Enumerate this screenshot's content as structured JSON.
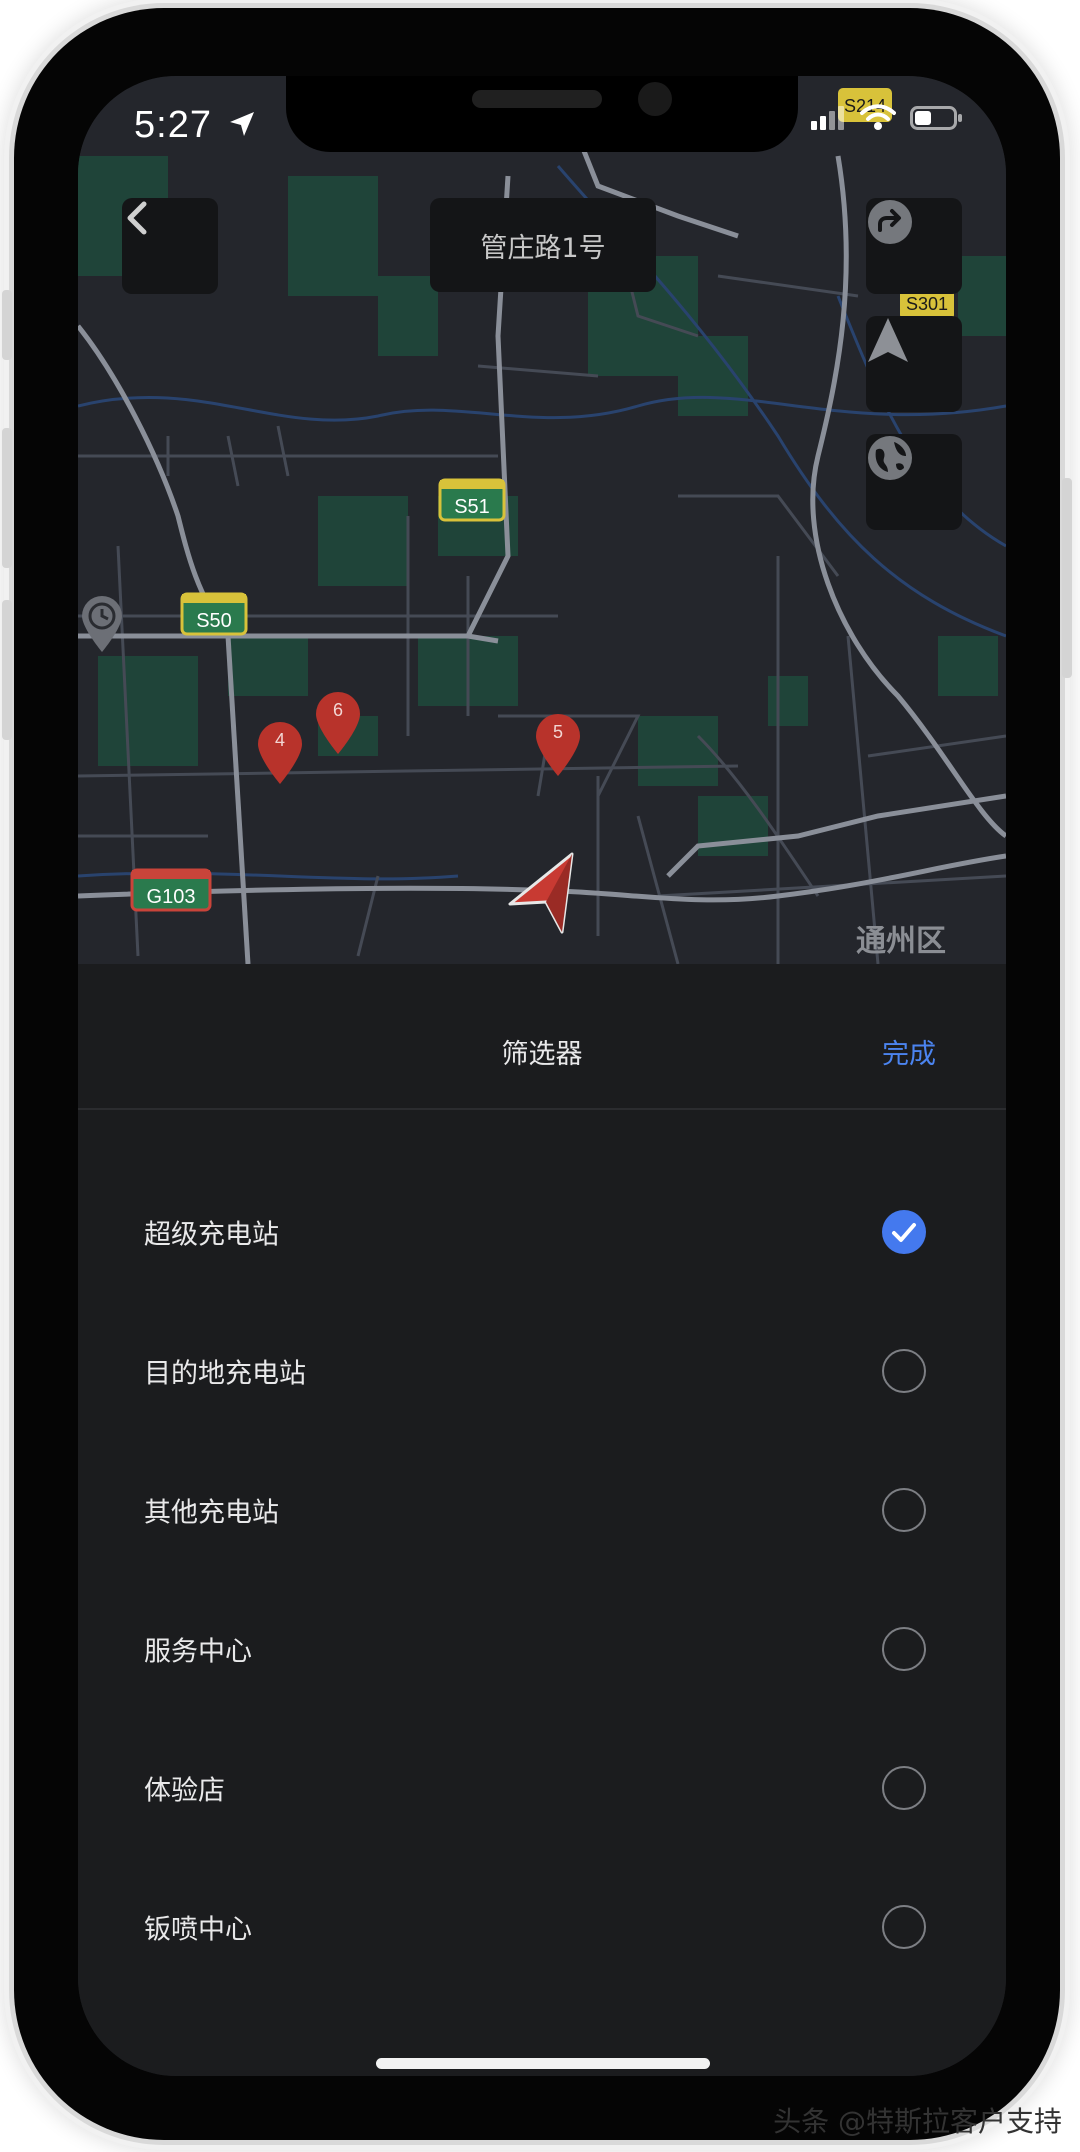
{
  "status_bar": {
    "time": "5:27"
  },
  "map": {
    "title": "管庄路1号",
    "district_label": "通州区",
    "road_shields": [
      "S214",
      "S301",
      "S51",
      "S50",
      "G103"
    ],
    "pins": [
      "4",
      "6",
      "5"
    ],
    "icons": [
      "back-icon",
      "share-icon",
      "navigate-icon",
      "globe-icon",
      "clock-icon"
    ]
  },
  "sheet": {
    "title": "筛选器",
    "done": "完成",
    "options": [
      {
        "label": "超级充电站",
        "checked": true
      },
      {
        "label": "目的地充电站",
        "checked": false
      },
      {
        "label": "其他充电站",
        "checked": false
      },
      {
        "label": "服务中心",
        "checked": false
      },
      {
        "label": "体验店",
        "checked": false
      },
      {
        "label": "钣喷中心",
        "checked": false
      }
    ]
  },
  "watermark": "头条 @特斯拉客户支持",
  "colors": {
    "accent": "#4b84f0",
    "checkbox": "#4479ee",
    "pin": "#c0392b",
    "sheet_bg": "#1b1c1e"
  }
}
